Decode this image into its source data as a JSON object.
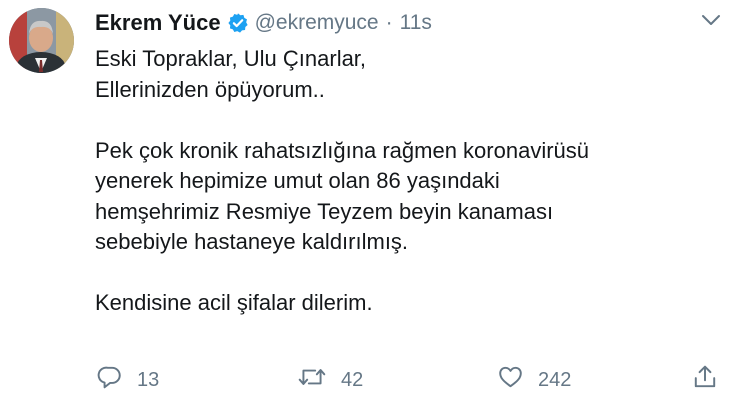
{
  "tweet": {
    "author_name": "Ekrem Yüce",
    "handle": "@ekremyuce",
    "separator": "·",
    "time": "11s",
    "text_lines": [
      "Eski Topraklar, Ulu Çınarlar,",
      "Ellerinizden öpüyorum..",
      "Pek çok kronik rahatsızlığına rağmen koronavirüsü",
      "yenerek hepimize umut olan 86 yaşındaki",
      "hemşehrimiz Resmiye Teyzem beyin kanaması",
      "sebebiyle hastaneye kaldırılmış.",
      "Kendisine acil şifalar dilerim."
    ]
  },
  "actions": {
    "reply_count": "13",
    "retweet_count": "42",
    "like_count": "242"
  },
  "colors": {
    "text": "#14171a",
    "secondary": "#657786",
    "verified": "#1da1f2"
  },
  "icons": [
    "verified-badge-icon",
    "chevron-down-icon",
    "reply-icon",
    "retweet-icon",
    "like-icon",
    "share-icon"
  ]
}
